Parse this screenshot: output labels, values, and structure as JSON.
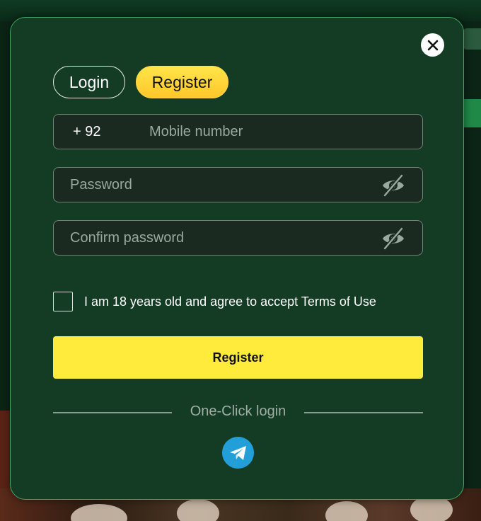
{
  "modal": {
    "tabs": [
      {
        "label": "Login",
        "active": false
      },
      {
        "label": "Register",
        "active": true
      }
    ],
    "phone": {
      "prefix": "+ 92",
      "placeholder": "Mobile number",
      "value": ""
    },
    "password": {
      "placeholder": "Password",
      "value": ""
    },
    "confirm_password": {
      "placeholder": "Confirm password",
      "value": ""
    },
    "agree": {
      "label": "I am 18 years old and agree to accept Terms of Use",
      "checked": false
    },
    "register_button": "Register",
    "one_click_label": "One-Click login",
    "icons": {
      "close": "close-icon",
      "eye": "eye-off-icon",
      "telegram": "telegram-icon"
    },
    "colors": {
      "panel": "#143c24",
      "panel_border": "#3fa761",
      "accent_yellow": "#ffeb3b",
      "telegram_blue": "#229ed9"
    }
  }
}
